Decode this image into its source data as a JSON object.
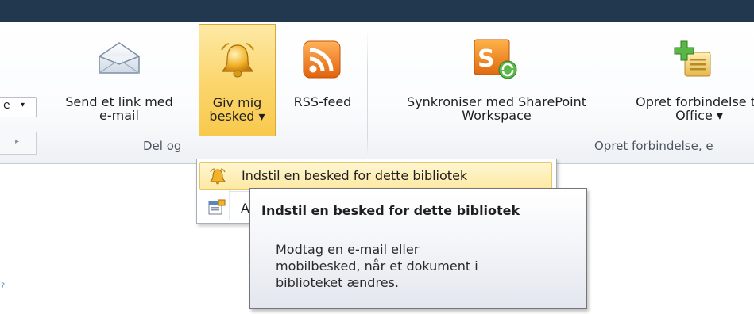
{
  "ribbon": {
    "left_dropdown_text": "e",
    "left_dropdown_arrow": "▾",
    "left_scroll_arrow": "▸",
    "buttons": {
      "send_link": {
        "line1": "Send et link med",
        "line2": "e-mail",
        "icon": "envelope-icon"
      },
      "giv_besked": {
        "line1": "Giv mig",
        "line2": "besked ▾",
        "icon": "bell-icon"
      },
      "rss": {
        "line1": "RSS-feed",
        "icon": "rss-icon"
      },
      "sync": {
        "line1": "Synkroniser med SharePoint",
        "line2": "Workspace",
        "icon": "sharepoint-workspace-icon"
      },
      "opret": {
        "line1": "Opret forbindelse til",
        "line2": "Office ▾",
        "icon": "connect-office-icon"
      }
    },
    "groups": {
      "share": "Del og",
      "connect": "Opret forbindelse, e"
    }
  },
  "dropdown": {
    "item1": "Indstil en besked for dette bibliotek",
    "item2": "A"
  },
  "tooltip": {
    "title": "Indstil en besked for dette bibliotek",
    "line1": "Modtag en e-mail eller",
    "line2": "mobilbesked, når et dokument i",
    "line3": "biblioteket ændres."
  },
  "stray_glyph": "ˀ",
  "colors": {
    "topbar": "#22384f",
    "highlight": "#fbd56b",
    "rss_orange": "#f07a1c"
  }
}
